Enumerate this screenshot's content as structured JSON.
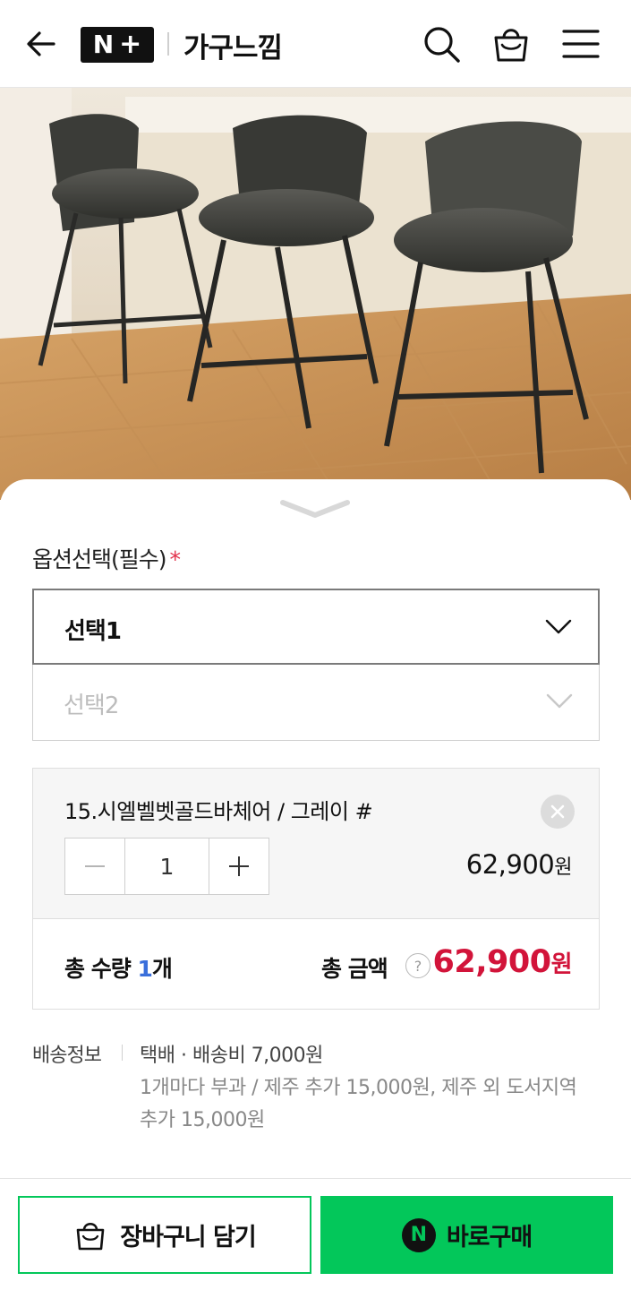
{
  "header": {
    "logo_text": "N",
    "logo_plus": "+",
    "brand_name": "가구느낌"
  },
  "options": {
    "title": "옵션선택(필수)",
    "required_mark": "*",
    "select1_label": "선택1",
    "select2_label": "선택2"
  },
  "selected_item": {
    "name": "15.시엘벨벳골드바체어 / 그레이 #",
    "quantity": "1",
    "price": "62,900",
    "price_unit": "원"
  },
  "totals": {
    "qty_label": "총 수량",
    "qty_value": "1",
    "qty_unit": "개",
    "amount_label": "총 금액",
    "help_symbol": "?",
    "amount_value": "62,900",
    "amount_unit": "원"
  },
  "shipping": {
    "label": "배송정보",
    "line1": "택배 · 배송비 7,000원",
    "line2": "1개마다 부과 / 제주 추가 15,000원, 제주 외 도서지역",
    "line3": "추가 15,000원"
  },
  "actions": {
    "cart_label": "장바구니 담기",
    "buy_label": "바로구매",
    "npay_glyph": "N"
  },
  "colors": {
    "accent_green": "#03c75a",
    "price_red": "#d2143a",
    "qty_blue": "#3a6fdb",
    "required_red": "#e2334c"
  }
}
